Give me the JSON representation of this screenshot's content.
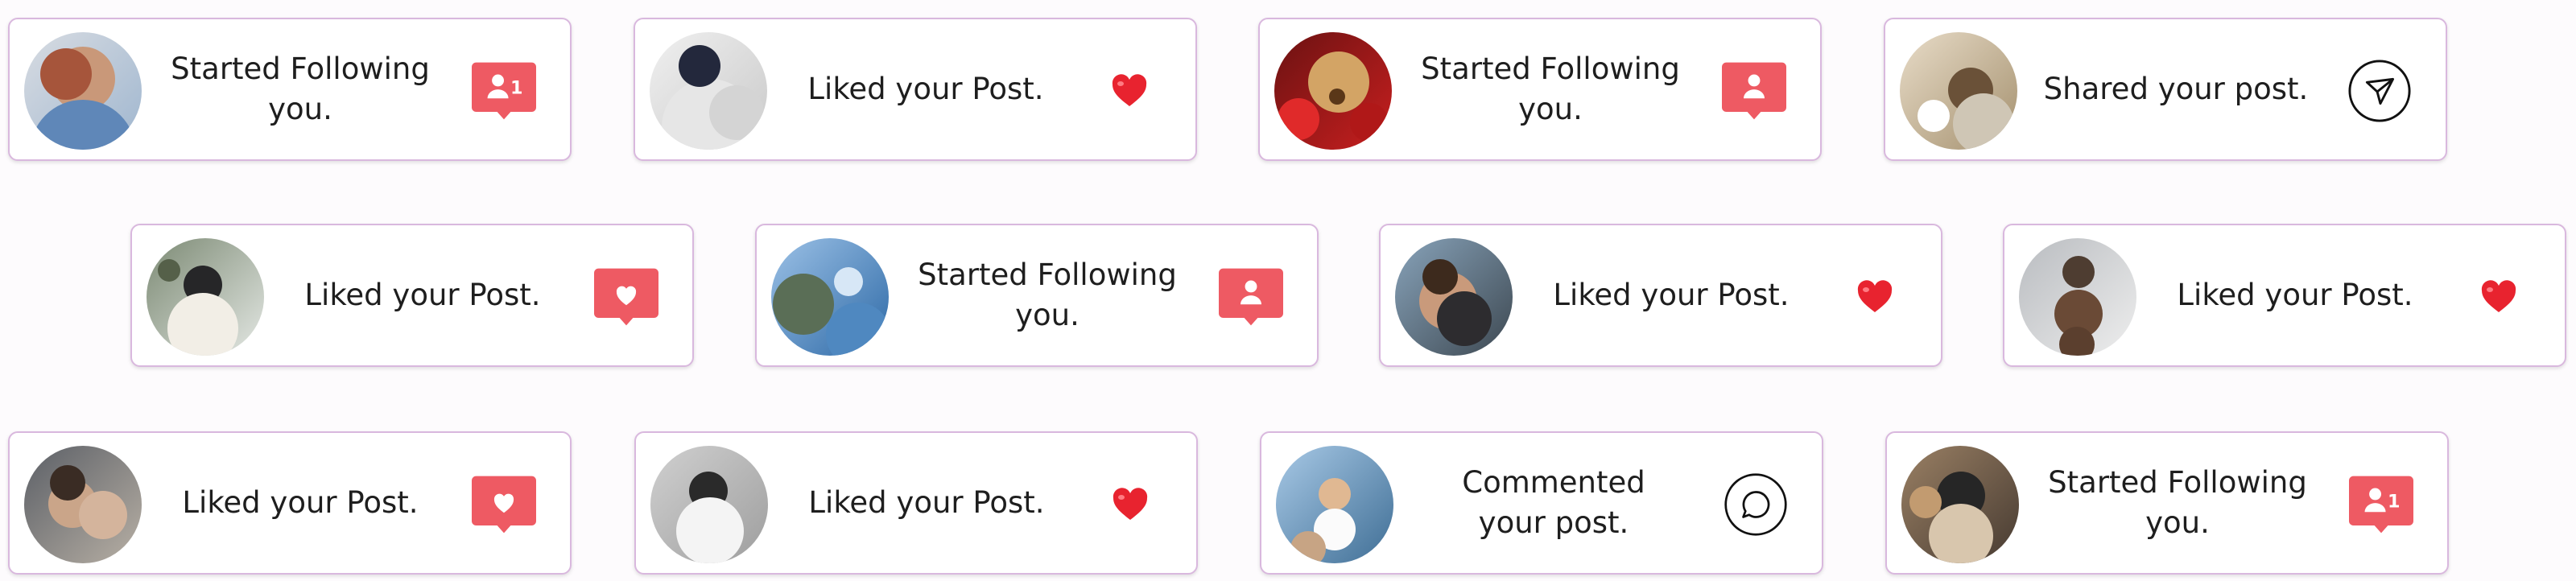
{
  "colors": {
    "accent": "#ee5a63",
    "border": "#d9b8de",
    "text": "#1e1e1e",
    "heart": "#e8232f"
  },
  "notifications": [
    {
      "text": "Started Following you.",
      "icon": "follow-badge-icon",
      "badge_count": "1",
      "avatar": "woman-in-light-blue-sweater-photo"
    },
    {
      "text": "Liked your Post.",
      "icon": "heart-emoji-icon",
      "avatar": "person-in-white-hoodie-and-cap-photo"
    },
    {
      "text": "Started Following you.",
      "icon": "follow-badge-icon",
      "avatar": "golden-retriever-with-red-flowers-photo"
    },
    {
      "text": "Shared your post.",
      "icon": "send-icon",
      "avatar": "woman-at-cafe-table-photo"
    },
    {
      "text": "Liked your Post.",
      "icon": "heart-badge-icon",
      "avatar": "woman-in-snowy-forest-photo"
    },
    {
      "text": "Started Following you.",
      "icon": "follow-badge-icon",
      "avatar": "coastal-cliffs-seascape-photo"
    },
    {
      "text": "Liked your Post.",
      "icon": "heart-emoji-icon",
      "avatar": "couple-hugging-at-beach-photo"
    },
    {
      "text": "Liked your Post.",
      "icon": "heart-emoji-icon",
      "avatar": "person-in-brown-outfit-photo"
    },
    {
      "text": "Liked your Post.",
      "icon": "heart-badge-icon",
      "avatar": "two-friends-in-car-photo"
    },
    {
      "text": "Liked your Post.",
      "icon": "heart-emoji-icon",
      "avatar": "mirror-selfie-in-white-photo"
    },
    {
      "text": "Commented your post.",
      "icon": "comment-icon",
      "avatar": "woman-in-white-dress-on-beach-photo"
    },
    {
      "text": "Started Following you.",
      "icon": "follow-badge-icon",
      "badge_count": "1",
      "avatar": "masked-mirror-selfie-photo"
    }
  ]
}
